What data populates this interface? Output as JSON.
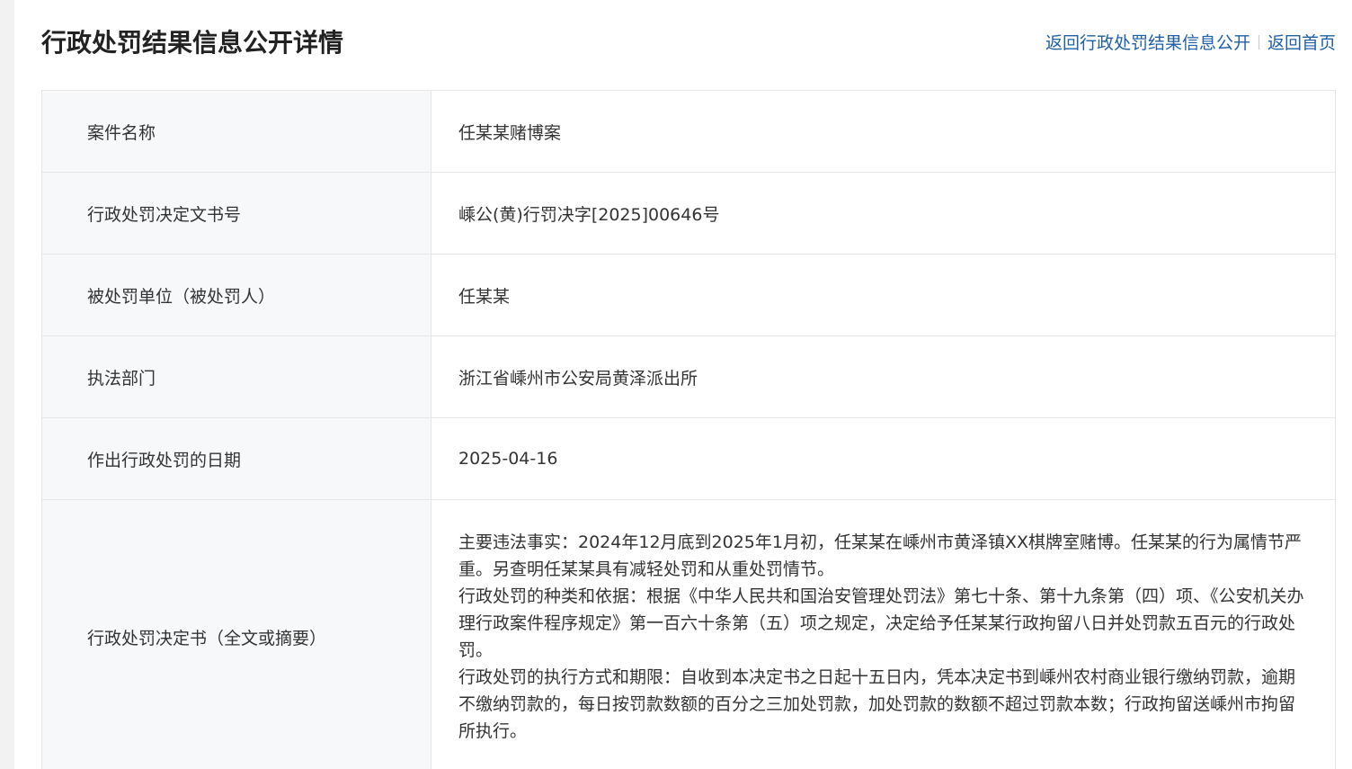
{
  "page": {
    "title": "行政处罚结果信息公开详情"
  },
  "nav": {
    "back_to_list": "返回行政处罚结果信息公开",
    "back_to_home": "返回首页"
  },
  "rows": [
    {
      "label": "案件名称",
      "value": "任某某赌博案"
    },
    {
      "label": "行政处罚决定文书号",
      "value": "嵊公(黄)行罚决字[2025]00646号"
    },
    {
      "label": "被处罚单位（被处罚人）",
      "value": "任某某"
    },
    {
      "label": "执法部门",
      "value": "浙江省嵊州市公安局黄泽派出所"
    },
    {
      "label": "作出行政处罚的日期",
      "value": "2025-04-16"
    }
  ],
  "decision": {
    "label": "行政处罚决定书（全文或摘要）",
    "paragraphs": [
      "主要违法事实：2024年12月底到2025年1月初，任某某在嵊州市黄泽镇XX棋牌室赌博。任某某的行为属情节严重。另查明任某某具有减轻处罚和从重处罚情节。",
      "行政处罚的种类和依据：根据《中华人民共和国治安管理处罚法》第七十条、第十九条第（四）项、《公安机关办理行政案件程序规定》第一百六十条第（五）项之规定，决定给予任某某行政拘留八日并处罚款五百元的行政处罚。",
      "行政处罚的执行方式和期限：自收到本决定书之日起十五日内，凭本决定书到嵊州农村商业银行缴纳罚款，逾期不缴纳罚款的，每日按罚款数额的百分之三加处罚款，加处罚款的数额不超过罚款本数；行政拘留送嵊州市拘留所执行。"
    ]
  }
}
